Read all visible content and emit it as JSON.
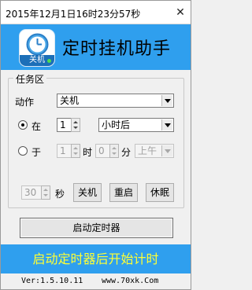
{
  "window": {
    "title": "2015年12月1日16时23分57秒",
    "close_glyph": "✕"
  },
  "banner": {
    "icon_label": "关机",
    "app_title": "定时挂机助手",
    "bg_color": "#2f9fee"
  },
  "task_group": {
    "legend": "任务区",
    "action_label": "动作",
    "action_value": "关机",
    "after_option": {
      "radio_label": "在",
      "amount": "1",
      "unit_value": "小时后",
      "checked": true
    },
    "at_option": {
      "radio_label": "于",
      "hour": "1",
      "hour_suffix": "时",
      "minute": "0",
      "minute_suffix": "分",
      "ampm_value": "上午",
      "checked": false
    },
    "seconds_value": "30",
    "seconds_suffix": "秒",
    "quick_buttons": {
      "shutdown": "关机",
      "restart": "重启",
      "sleep": "休眠"
    }
  },
  "start_button": "启动定时器",
  "status": {
    "text": "启动定时器后开始计时",
    "text_color": "#ffff33"
  },
  "footer": {
    "version": "Ver:1.5.10.11",
    "website": "www.70xk.Com"
  }
}
